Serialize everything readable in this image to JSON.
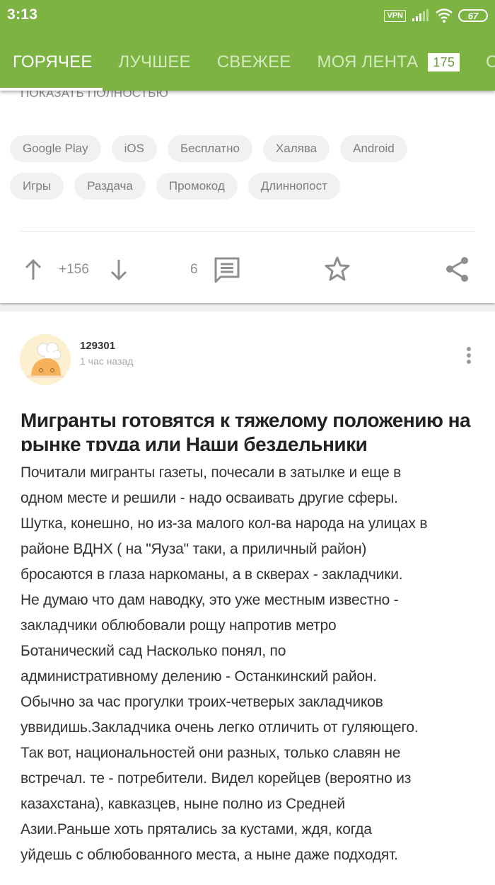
{
  "status": {
    "time": "3:13",
    "vpn": "VPN",
    "battery": "67"
  },
  "tabs": [
    {
      "label": "ГОРЯЧЕЕ",
      "active": true
    },
    {
      "label": "ЛУЧШЕЕ"
    },
    {
      "label": "СВЕЖЕЕ"
    },
    {
      "label": "МОЯ ЛЕНТА",
      "badge": "175"
    },
    {
      "label": "СО"
    }
  ],
  "prev_post": {
    "show_full": "ПОКАЗАТЬ ПОЛНОСТЬЮ",
    "tags_row1": [
      "Google Play",
      "iOS",
      "Бесплатно",
      "Халява",
      "Android"
    ],
    "tags_row2": [
      "Игры",
      "Раздача",
      "Промокод",
      "Длиннопост"
    ],
    "rating": "+156",
    "comments": "6"
  },
  "post": {
    "author": "129301",
    "time": "1 час назад",
    "title": "Мигранты готовятся к тяжелому положению на рынке труда или Наши бездельники",
    "body_lines": [
      "Почитали мигранты газеты, почесали в затылке и еще в",
      "одном месте и решили - надо осваивать другие сферы.",
      "Шутка, конешно, но из-за малого кол-ва народа на улицах в",
      "районе ВДНХ ( на \"Яуза\" таки, а приличный район)",
      "бросаются в глаза наркоманы, а в скверах - закладчики.",
      "Не думаю что дам наводку, это уже местным известно -",
      "закладчики облюбовали  рощу напротив метро",
      "Ботанический сад Насколько понял, по",
      "административному делению  - Останкинский район.",
      "Обычно за час  прогулки троих-четверых закладчиков",
      "уввидишь.Закладчика очень легко отличить от гуляющего.",
      "Так вот, национальностей они разных, только славян не",
      "встречал. те - потребители. Видел корейцев (вероятно из",
      "казахстана), кавказцев, ныне полно из Средней",
      "Азии.Раньше хоть прятались за кустами, ждя, когда",
      "уйдешь с облюбованного места, а ныне даже подходят."
    ]
  },
  "colors": {
    "accent": "#7cb342",
    "icon_gray": "#8e8e8e",
    "tag_bg": "#f1f1f1"
  }
}
